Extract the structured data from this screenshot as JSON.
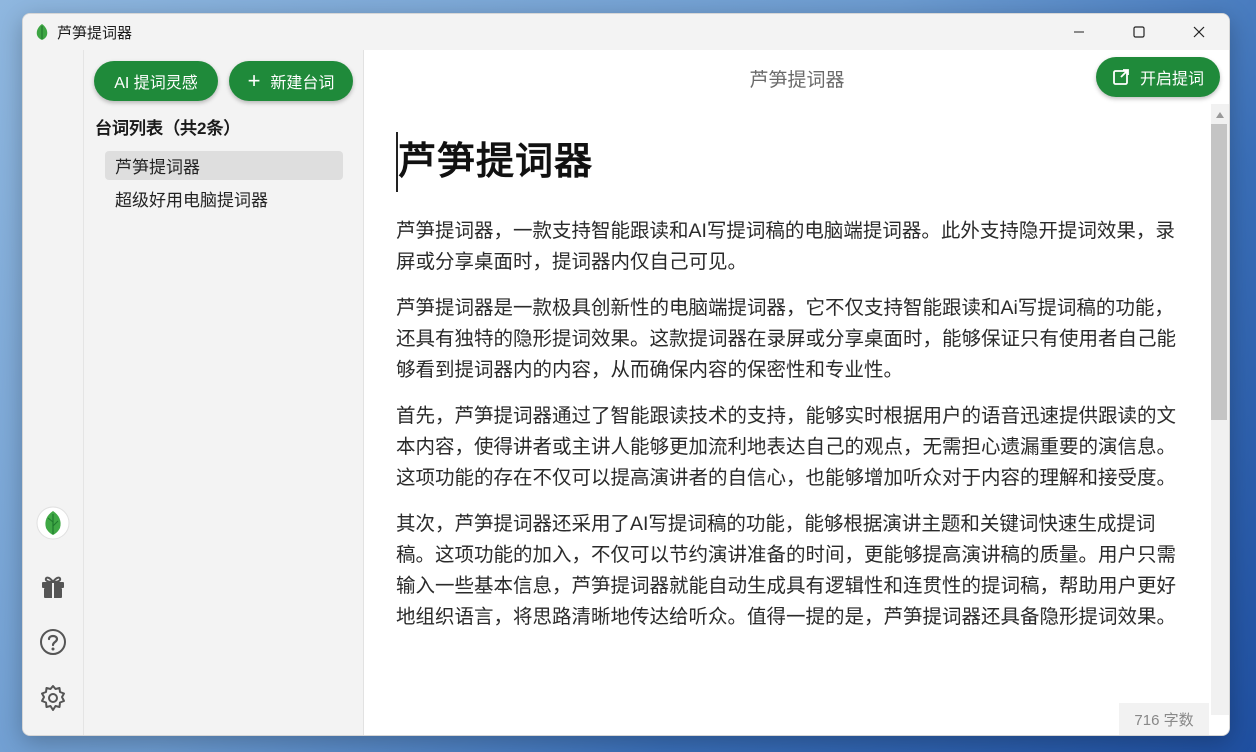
{
  "window": {
    "title": "芦笋提词器",
    "controls": [
      "minimize-icon",
      "maximize-icon",
      "close-icon"
    ]
  },
  "rail": {
    "icons": [
      "app-logo-leaf-icon",
      "gift-icon",
      "help-icon",
      "settings-icon"
    ]
  },
  "sidebar": {
    "ai_button_label": "AI 提词灵感",
    "new_button_label": "新建台词",
    "list_header": "台词列表（共2条）",
    "items": [
      {
        "label": "芦笋提词器",
        "selected": true
      },
      {
        "label": "超级好用电脑提词器",
        "selected": false
      }
    ]
  },
  "main": {
    "header_title": "芦笋提词器",
    "open_button_label": "开启提词",
    "doc_title": "芦笋提词器",
    "paragraphs": [
      "芦笋提词器，一款支持智能跟读和AI写提词稿的电脑端提词器。此外支持隐开提词效果，录屏或分享桌面时，提词器内仅自己可见。",
      "芦笋提词器是一款极具创新性的电脑端提词器，它不仅支持智能跟读和Ai写提词稿的功能，还具有独特的隐形提词效果。这款提词器在录屏或分享桌面时，能够保证只有使用者自己能够看到提词器内的内容，从而确保内容的保密性和专业性。",
      "首先，芦笋提词器通过了智能跟读技术的支持，能够实时根据用户的语音迅速提供跟读的文本内容，使得讲者或主讲人能够更加流利地表达自己的观点，无需担心遗漏重要的演信息。这项功能的存在不仅可以提高演讲者的自信心，也能够增加听众对于内容的理解和接受度。",
      "其次，芦笋提词器还采用了AI写提词稿的功能，能够根据演讲主题和关键词快速生成提词稿。这项功能的加入，不仅可以节约演讲准备的时间，更能够提高演讲稿的质量。用户只需输入一些基本信息，芦笋提词器就能自动生成具有逻辑性和连贯性的提词稿，帮助用户更好地组织语言，将思路清晰地传达给听众。值得一提的是，芦笋提词器还具备隐形提词效果。"
    ],
    "word_count": "716 字数"
  },
  "colors": {
    "accent_green": "#1f8a3a",
    "selected_bg": "#dedede",
    "panel_bg": "#f3f3f3"
  }
}
